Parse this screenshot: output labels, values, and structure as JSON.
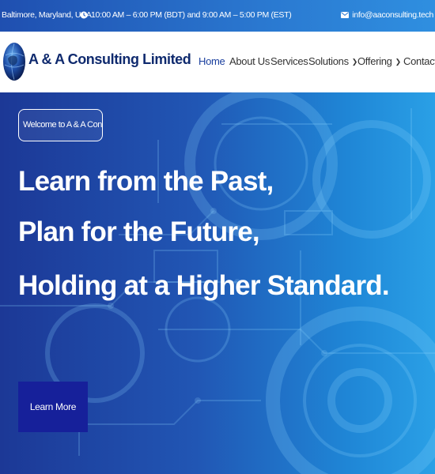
{
  "topbar": {
    "location": "Baltimore, Maryland, USA",
    "hours": "10:00 AM – 6:00 PM (BDT) and 9:00 AM – 5:00 PM (EST)",
    "email": "info@aaconsulting.tech"
  },
  "header": {
    "brand": "A & A Consulting Limited",
    "nav": [
      {
        "label": "Home",
        "active": true
      },
      {
        "label": "About Us"
      },
      {
        "label": "Services"
      },
      {
        "label": "Solutions",
        "has_dropdown": true
      },
      {
        "label": "Offering",
        "has_dropdown": true
      },
      {
        "label": "Contact"
      }
    ]
  },
  "hero": {
    "welcome": "Welcome to A & A Consulting Limited",
    "lines": [
      "Learn from the Past,",
      "Plan for the Future,",
      "Holding at a Higher Standard."
    ],
    "cta": "Learn More"
  },
  "colors": {
    "brand_navy": "#0f2a6e",
    "nav_active": "#1a3f9e",
    "cta_bg": "#16209a"
  },
  "icons": {
    "clock": "clock-icon",
    "mail": "mail-icon",
    "logo": "globe-logo-icon",
    "dropdown": "chevron-down-icon"
  }
}
